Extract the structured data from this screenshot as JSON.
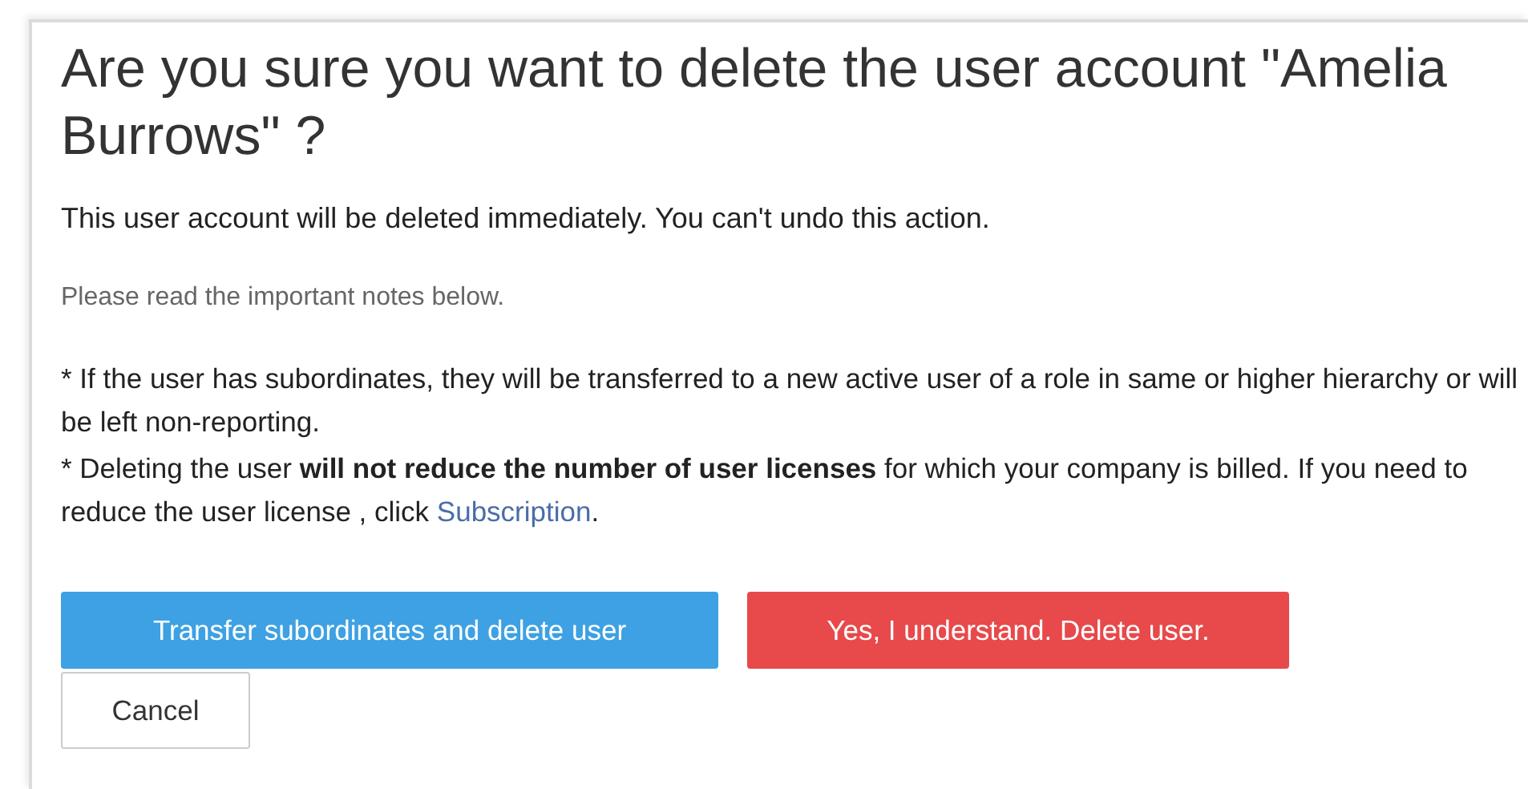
{
  "dialog": {
    "title": "Are you sure you want to delete the user account \"Amelia Burrows\" ?",
    "message": "This user account will be deleted immediately. You can't undo this action.",
    "hint": "Please read the important notes below.",
    "notes": [
      {
        "text": "* If the user has subordinates, they will be transferred to a new active user of a role in same or higher hierarchy or will be left non-reporting."
      },
      {
        "text": "* Deleting the user **will not reduce the number of user licenses** for which your company is billed. If you need to reduce the user license ,  click ",
        "link": "Subscription",
        "text_after": "."
      }
    ],
    "buttons": [
      {
        "label": "Transfer subordinates and delete user",
        "kind": "primary"
      },
      {
        "label": "Yes, I understand. Delete user.",
        "kind": "danger"
      },
      {
        "label": "Cancel",
        "kind": "secondary"
      }
    ]
  }
}
